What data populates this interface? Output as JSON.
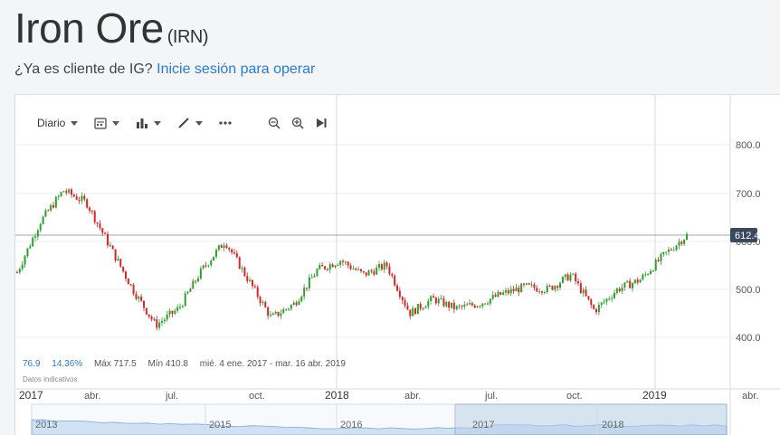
{
  "header": {
    "title": "Iron Ore",
    "ticker": "(IRN)",
    "login_prompt": "¿Ya es cliente de IG?",
    "login_link": "Inicie sesión para operar"
  },
  "toolbar": {
    "interval_label": "Diario",
    "icons": [
      "calendar-icon",
      "bar-chart-icon",
      "pencil-icon",
      "more-icon",
      "zoom-out-icon",
      "zoom-in-icon",
      "play-end-icon"
    ]
  },
  "stats": {
    "change": "76.9",
    "change_pct": "14.36%",
    "max": "Máx 717.5",
    "min": "Mín 410.8",
    "range": "mié. 4 ene. 2017 - mar. 16 abr. 2019",
    "note": "Datos indicativos"
  },
  "price_badge": "612.4",
  "colors": {
    "up": "#2ca02c",
    "down": "#d62728",
    "badge": "#3a4a5c",
    "link": "#2a7bc7"
  },
  "chart_data": {
    "type": "candlestick",
    "y_ticks": [
      "800.0",
      "700.0",
      "600.0",
      "500.0",
      "400.0"
    ],
    "y_range": [
      400,
      800
    ],
    "x_ticks": [
      "2017",
      "abr.",
      "jul.",
      "oct.",
      "2018",
      "abr.",
      "jul.",
      "oct.",
      "2019",
      "abr."
    ],
    "current_price": 612.4,
    "series": [
      {
        "t": "2017-01",
        "v": 535
      },
      {
        "t": "2017-02",
        "v": 640
      },
      {
        "t": "2017-02b",
        "v": 705
      },
      {
        "t": "2017-03",
        "v": 680
      },
      {
        "t": "2017-04",
        "v": 590
      },
      {
        "t": "2017-05",
        "v": 500
      },
      {
        "t": "2017-06",
        "v": 425
      },
      {
        "t": "2017-07",
        "v": 460
      },
      {
        "t": "2017-08",
        "v": 540
      },
      {
        "t": "2017-09",
        "v": 600
      },
      {
        "t": "2017-10",
        "v": 520
      },
      {
        "t": "2017-11",
        "v": 440
      },
      {
        "t": "2017-12",
        "v": 470
      },
      {
        "t": "2018-01",
        "v": 540
      },
      {
        "t": "2018-02",
        "v": 560
      },
      {
        "t": "2018-03",
        "v": 530
      },
      {
        "t": "2018-03b",
        "v": 550
      },
      {
        "t": "2018-04",
        "v": 450
      },
      {
        "t": "2018-05",
        "v": 480
      },
      {
        "t": "2018-06",
        "v": 460
      },
      {
        "t": "2018-07",
        "v": 470
      },
      {
        "t": "2018-08",
        "v": 490
      },
      {
        "t": "2018-09",
        "v": 505
      },
      {
        "t": "2018-10",
        "v": 500
      },
      {
        "t": "2018-11",
        "v": 530
      },
      {
        "t": "2018-12",
        "v": 455
      },
      {
        "t": "2019-01",
        "v": 500
      },
      {
        "t": "2019-02",
        "v": 520
      },
      {
        "t": "2019-03",
        "v": 570
      },
      {
        "t": "2019-04",
        "v": 612
      }
    ],
    "navigator_labels": [
      "2013",
      "2015",
      "2016",
      "2017",
      "2018"
    ]
  }
}
